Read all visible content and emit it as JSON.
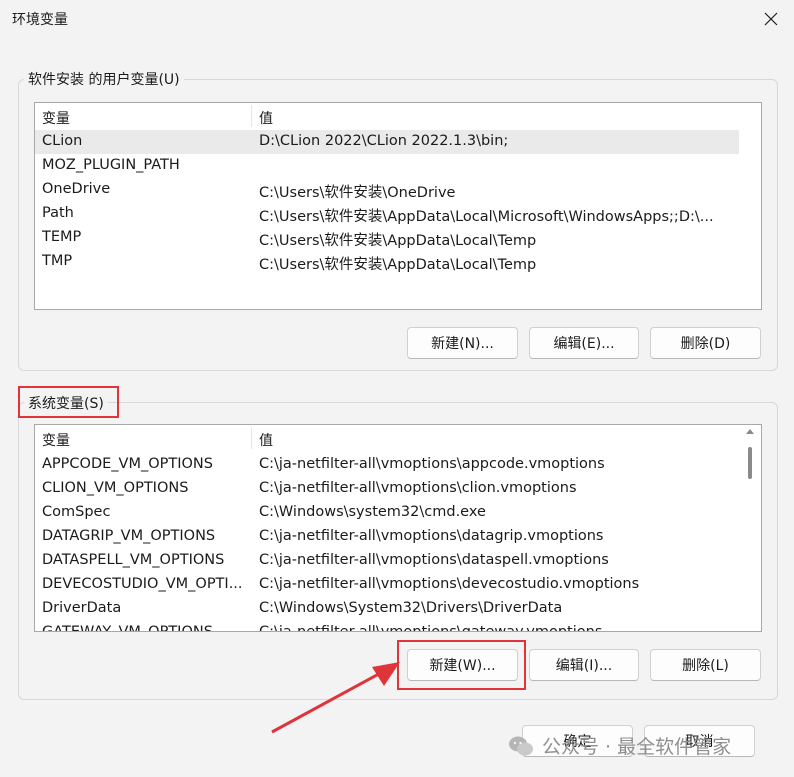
{
  "window": {
    "title": "环境变量",
    "close_glyph": "✕"
  },
  "user_vars": {
    "legend": "软件安装 的用户变量(U)",
    "col_var": "变量",
    "col_val": "值",
    "rows": [
      {
        "name": "CLion",
        "value": "D:\\CLion 2022\\CLion 2022.1.3\\bin;"
      },
      {
        "name": "MOZ_PLUGIN_PATH",
        "value": ""
      },
      {
        "name": "OneDrive",
        "value": "C:\\Users\\软件安装\\OneDrive"
      },
      {
        "name": "Path",
        "value": "C:\\Users\\软件安装\\AppData\\Local\\Microsoft\\WindowsApps;;D:\\..."
      },
      {
        "name": "TEMP",
        "value": "C:\\Users\\软件安装\\AppData\\Local\\Temp"
      },
      {
        "name": "TMP",
        "value": "C:\\Users\\软件安装\\AppData\\Local\\Temp"
      }
    ],
    "new_label": "新建(N)...",
    "edit_label": "编辑(E)...",
    "delete_label": "删除(D)"
  },
  "system_vars": {
    "legend": "系统变量(S)",
    "col_var": "变量",
    "col_val": "值",
    "rows": [
      {
        "name": "APPCODE_VM_OPTIONS",
        "value": "C:\\ja-netfilter-all\\vmoptions\\appcode.vmoptions"
      },
      {
        "name": "CLION_VM_OPTIONS",
        "value": "C:\\ja-netfilter-all\\vmoptions\\clion.vmoptions"
      },
      {
        "name": "ComSpec",
        "value": "C:\\Windows\\system32\\cmd.exe"
      },
      {
        "name": "DATAGRIP_VM_OPTIONS",
        "value": "C:\\ja-netfilter-all\\vmoptions\\datagrip.vmoptions"
      },
      {
        "name": "DATASPELL_VM_OPTIONS",
        "value": "C:\\ja-netfilter-all\\vmoptions\\dataspell.vmoptions"
      },
      {
        "name": "DEVECOSTUDIO_VM_OPTI...",
        "value": "C:\\ja-netfilter-all\\vmoptions\\devecostudio.vmoptions"
      },
      {
        "name": "DriverData",
        "value": "C:\\Windows\\System32\\Drivers\\DriverData"
      },
      {
        "name": "GATEWAY_VM_OPTIONS",
        "value": "C:\\ja-netfilter-all\\vmoptions\\gateway.vmoptions"
      }
    ],
    "new_label": "新建(W)...",
    "edit_label": "编辑(I)...",
    "delete_label": "删除(L)"
  },
  "footer": {
    "ok_label": "确定",
    "cancel_label": "取消"
  },
  "watermark": {
    "text": "公众号 · 最全软件管家",
    "icon": "wechat-icon"
  },
  "colors": {
    "highlight": "#e0343b",
    "arrow": "#e0343b"
  }
}
